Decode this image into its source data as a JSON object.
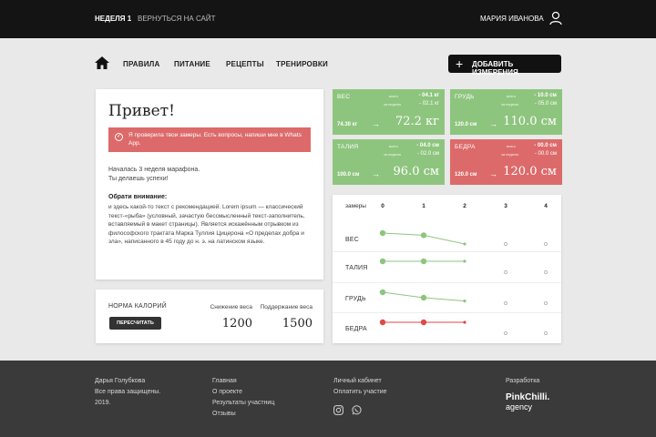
{
  "topbar": {
    "week": "НЕДЕЛЯ 1",
    "back_link": "ВЕРНУТЬСЯ НА САЙТ",
    "user_name": "МАРИЯ ИВАНОВА",
    "user_icon": "user-icon"
  },
  "nav": {
    "home_icon": "home-icon",
    "items": [
      "ПРАВИЛА",
      "ПИТАНИЕ",
      "РЕЦЕПТЫ",
      "ТРЕНИРОВКИ"
    ],
    "add_button": "ДОБАВИТЬ ИЗМЕРЕНИЯ"
  },
  "greeting": {
    "title": "Привет!",
    "alert": "Я проверила твои замеры. Есть вопросы, напиши мне в Whats App.",
    "intro_line1": "Началась 3 неделя марафона.",
    "intro_line2": "Ты делаешь успехи!",
    "attention": "Обрати внимание:",
    "body": "и здесь какой-то текст с рекомендацией. Lorem ipsum — классический текст-«рыба» (условный, зачастую бессмысленный текст-заполнитель, вставляемый в макет страницы). Является искажённым отрывком из философского трактата Марка Туллия Цицерона «О пределах добра и зла», написанного в 45 году до н. э. на латинском языке."
  },
  "calories": {
    "title": "НОРМА КАЛОРИЙ",
    "recalc_button": "ПЕРЕСЧИТАТЬ",
    "loss_label": "Снижение веса",
    "loss_value": "1200",
    "keep_label": "Поддержание веса",
    "keep_value": "1500"
  },
  "measurements": [
    {
      "name": "ВЕС",
      "status": "green",
      "week_label": "всего",
      "week_delta": "- 04.1 кг",
      "total_label": "за неделю",
      "total_delta": "- 02.1 кг",
      "start": "74.30 кг",
      "arrow": "→",
      "current": "72.2 кг"
    },
    {
      "name": "ГРУДЬ",
      "status": "green",
      "week_label": "всего",
      "week_delta": "- 10.0 см",
      "total_label": "за неделю",
      "total_delta": "- 05.0 см",
      "start": "120.0 см",
      "arrow": "→",
      "current": "110.0 см"
    },
    {
      "name": "ТАЛИЯ",
      "status": "green",
      "week_label": "всего",
      "week_delta": "- 04.0 см",
      "total_label": "за неделю",
      "total_delta": "- 02.0 см",
      "start": "100.0 см",
      "arrow": "→",
      "current": "96.0 см"
    },
    {
      "name": "БЕДРА",
      "status": "red",
      "week_label": "всего",
      "week_delta": "- 00.0 см",
      "total_label": "за неделю",
      "total_delta": "- 00.0 см",
      "start": "120.0 см",
      "arrow": "→",
      "current": "120.0 см"
    }
  ],
  "progress": {
    "header": "замеры",
    "columns": [
      "0",
      "1",
      "2",
      "3",
      "4"
    ],
    "rows": [
      {
        "label": "ВЕС",
        "color": "#8ec57e",
        "levels": [
          0.0,
          0.2,
          1.0
        ],
        "filled": 3
      },
      {
        "label": "ТАЛИЯ",
        "color": "#8ec57e",
        "levels": [
          0.0,
          0.0,
          0.0
        ],
        "filled": 3
      },
      {
        "label": "ГРУДЬ",
        "color": "#8ec57e",
        "levels": [
          0.0,
          0.5,
          0.8
        ],
        "filled": 3
      },
      {
        "label": "БЕДРА",
        "color": "#dd4a4a",
        "levels": [
          0.0,
          0.0,
          0.0
        ],
        "filled": 3
      }
    ]
  },
  "footer": {
    "author": "Дарья Голубкова",
    "rights": "Все права защищены.",
    "year": "2019.",
    "links": [
      "Главная",
      "О проекте",
      "Результаты участниц",
      "Отзывы"
    ],
    "cabinet": "Личный кабинет",
    "pay": "Оплатить участие",
    "social_icons": [
      "instagram-icon",
      "whatsapp-icon"
    ],
    "dev_label": "Разработка",
    "dev_logo": "PinkChilli.",
    "dev_logo_sub": "agency"
  }
}
